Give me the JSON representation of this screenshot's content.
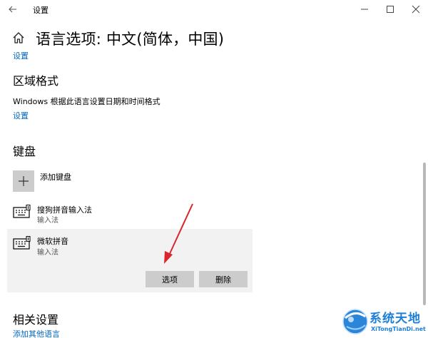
{
  "window": {
    "title": "设置",
    "controls": [
      "minimize-icon",
      "maximize-icon",
      "close-icon"
    ]
  },
  "header": {
    "title": "语言选项: 中文(简体，中国)",
    "settings_link": "设置"
  },
  "region": {
    "heading": "区域格式",
    "description": "Windows 根据此语言设置日期和时间格式",
    "settings_link": "设置"
  },
  "keyboard": {
    "heading": "键盘",
    "add_label": "添加键盘",
    "items": [
      {
        "name": "搜狗拼音输入法",
        "type": "输入法"
      },
      {
        "name": "微软拼音",
        "type": "输入法"
      }
    ],
    "options_button": "选项",
    "delete_button": "删除"
  },
  "related": {
    "heading": "相关设置",
    "add_other_link": "添加其他语言"
  },
  "watermark": {
    "title": "系统天地",
    "url": "XiTongTianDi.net"
  },
  "colors": {
    "accent_link": "#0067c0",
    "selected_background": "#f2f2f2",
    "button_background": "#cccccc",
    "annotation_arrow": "#d8262c",
    "watermark_blue": "#1e7fd6"
  }
}
